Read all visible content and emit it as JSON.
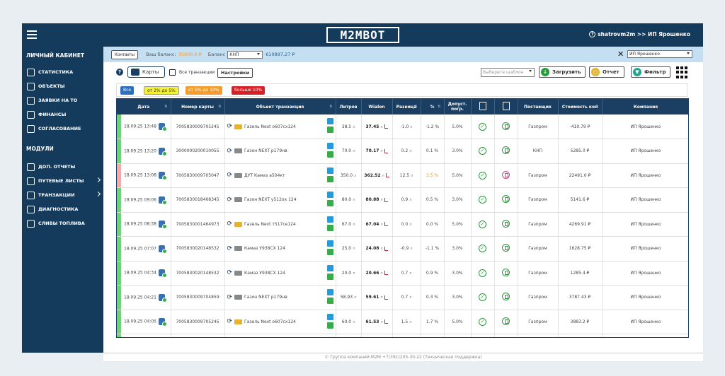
{
  "header": {
    "logo": "M2MBOT",
    "user": "shatrovm2m >> ИП Ярошенко"
  },
  "sidebar": {
    "section1": "ЛИЧНЫЙ КАБИНЕТ",
    "items1": [
      "СТАТИСТИКА",
      "ОБЪЕКТЫ",
      "ЗАЯВКИ НА ТО",
      "ФИНАНСЫ",
      "СОГЛАСОВАНИЕ"
    ],
    "section2": "МОДУЛИ",
    "items2": [
      "ДОП. ОТЧЕТЫ",
      "ПУТЕВЫЕ ЛИСТЫ",
      "ТРАНЗАКЦИИ",
      "ДИАГНОСТИКА",
      "СЛИВЫ ТОПЛИВА"
    ]
  },
  "balance": {
    "contacts": "Контакты",
    "your_balance_label": "Ваш баланс:",
    "your_balance_value": "35600,0 ₽",
    "balance_label": "Баланс",
    "balance_select": "КНП",
    "balance_value": "610897,27 ₽",
    "company_select": "ИП Ярошенко"
  },
  "toolbar": {
    "cards": "Карты",
    "all_transactions": "Все транзакции",
    "settings": "Настройки",
    "template_placeholder": "Выберите шаблон",
    "load": "Загрузить",
    "report": "Отчет",
    "filter": "Фильтр"
  },
  "chips": {
    "all": "Все",
    "c1": "от 2% до 5%",
    "c2": "от 5% до 10%",
    "c3": "больше 10%"
  },
  "colors": {
    "navy": "#143a5c",
    "green_status": "#6fd27a",
    "red_status": "#f4a9ab"
  },
  "table": {
    "headers": [
      "Дата",
      "Номер карты",
      "Объект транзакция",
      "Литров",
      "Wialon",
      "Разница",
      "%",
      "Допуст. погр.",
      "",
      "",
      "Поставщик",
      "Стоимость кон",
      "Компания"
    ],
    "rows": [
      {
        "status": "green",
        "date": "18.09.25 13:48",
        "card": "7005830009705245",
        "object": "Газель Next о607сх124",
        "truck": "y",
        "liters": "38.5",
        "wialon": "37.45",
        "diff": "-1.0",
        "pct": "-1.2 %",
        "pct_orange": false,
        "tol": "5.0%",
        "doc_red": false,
        "supplier": "Газпром",
        "cost": "-410.79 ₽",
        "company": "ИП Ярошенко"
      },
      {
        "status": "green",
        "date": "18.09.25 13:20",
        "card": "3000000200010055",
        "object": "Газон NEXT р179нв",
        "truck": "g",
        "liters": "70.0",
        "wialon": "70.17",
        "diff": "0.2",
        "pct": "0.1 %",
        "pct_orange": false,
        "tol": "3.0%",
        "doc_red": false,
        "supplier": "КНП",
        "cost": "5285.0 ₽",
        "company": "ИП Ярошенко"
      },
      {
        "status": "red",
        "date": "18.09.25 13:08",
        "card": "7005830009705047",
        "object": "ДУТ Камаз а504кт",
        "truck": "g",
        "liters": "350.0",
        "wialon": "362.52",
        "diff": "12.5",
        "pct": "3.5 %",
        "pct_orange": true,
        "tol": "5.0%",
        "doc_red": true,
        "supplier": "Газпром",
        "cost": "22491.0 ₽",
        "company": "ИП Ярошенко"
      },
      {
        "status": "green",
        "date": "18.09.25 09:06",
        "card": "7005830018468345",
        "object": "Газон NEXT у512ох 124",
        "truck": "g",
        "liters": "80.0",
        "wialon": "80.88",
        "diff": "0.9",
        "pct": "0.5 %",
        "pct_orange": false,
        "tol": "3.0%",
        "doc_red": false,
        "supplier": "Газпром",
        "cost": "5141.6 ₽",
        "company": "ИП Ярошенко"
      },
      {
        "status": "green",
        "date": "18.09.25 08:38",
        "card": "7005830001464973",
        "object": "Газель Next т517се124",
        "truck": "y",
        "liters": "67.0",
        "wialon": "67.04",
        "diff": "0.0",
        "pct": "0.0 %",
        "pct_orange": false,
        "tol": "5.0%",
        "doc_red": false,
        "supplier": "Газпром",
        "cost": "4269.91 ₽",
        "company": "ИП Ярошенко"
      },
      {
        "status": "green",
        "date": "18.09.25 07:07",
        "card": "7005830020148532",
        "object": "Камаз У938СХ 124",
        "truck": "g",
        "liters": "25.0",
        "wialon": "24.08",
        "diff": "-0.9",
        "pct": "-1.1 %",
        "pct_orange": false,
        "tol": "3.0%",
        "doc_red": false,
        "supplier": "Газпром",
        "cost": "1628.75 ₽",
        "company": "ИП Ярошенко"
      },
      {
        "status": "green",
        "date": "18.09.25 04:34",
        "card": "7005830020148532",
        "object": "Камаз У938СХ 124",
        "truck": "g",
        "liters": "20.0",
        "wialon": "20.66",
        "diff": "0.7",
        "pct": "0.9 %",
        "pct_orange": false,
        "tol": "3.0%",
        "doc_red": false,
        "supplier": "Газпром",
        "cost": "1285.4 ₽",
        "company": "ИП Ярошенко"
      },
      {
        "status": "green",
        "date": "18.09.25 04:21",
        "card": "7005830009704859",
        "object": "Газон NEXT р179нв",
        "truck": "g",
        "liters": "58.93",
        "wialon": "59.61",
        "diff": "0.7",
        "pct": "0.3 %",
        "pct_orange": false,
        "tol": "3.0%",
        "doc_red": false,
        "supplier": "Газпром",
        "cost": "3787.43 ₽",
        "company": "ИП Ярошенко"
      },
      {
        "status": "green",
        "date": "18.09.25 04:05",
        "card": "7005830009705245",
        "object": "Газель Next о607сх124",
        "truck": "y",
        "liters": "60.0",
        "wialon": "61.53",
        "diff": "1.5",
        "pct": "1.7 %",
        "pct_orange": false,
        "tol": "5.0%",
        "doc_red": false,
        "supplier": "Газпром",
        "cost": "3883.2 ₽",
        "company": "ИП Ярошенко"
      },
      {
        "status": "green",
        "date": "",
        "card": "",
        "object": "",
        "truck": "",
        "liters": "",
        "wialon": "",
        "diff": "",
        "pct": "",
        "pct_orange": false,
        "tol": "",
        "doc_red": false,
        "supplier": "",
        "cost": "",
        "company": ""
      }
    ]
  },
  "footer": "© Группа компаний М2М +7(391)205-30-22 (Техническая поддержка)"
}
